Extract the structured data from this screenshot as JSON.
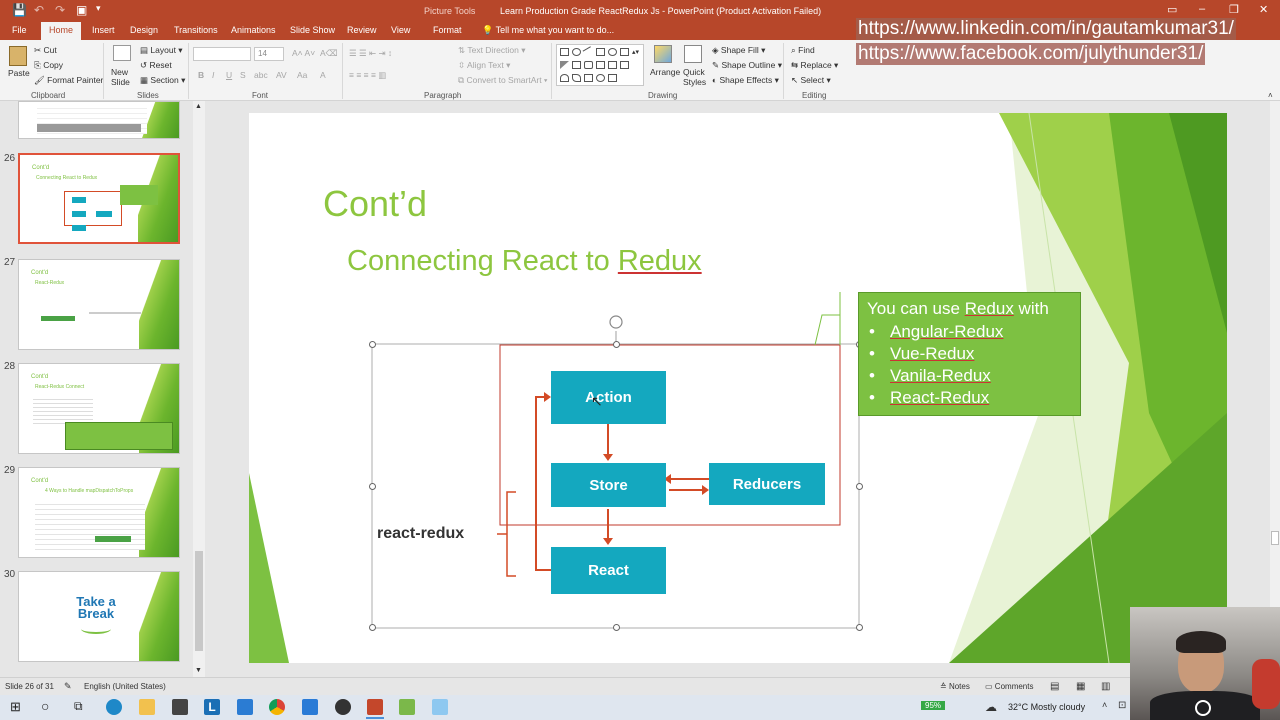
{
  "window": {
    "context_tab_label": "Picture Tools",
    "title": "Learn Production Grade ReactRedux Js - PowerPoint (Product Activation Failed)"
  },
  "tabs": [
    "File",
    "Home",
    "Insert",
    "Design",
    "Transitions",
    "Animations",
    "Slide Show",
    "Review",
    "View",
    "Format"
  ],
  "active_tab": "Home",
  "tell_me_placeholder": "Tell me what you want to do...",
  "ribbon": {
    "clipboard": {
      "paste": "Paste",
      "cut": "Cut",
      "copy": "Copy",
      "format_painter": "Format Painter",
      "group": "Clipboard"
    },
    "slides": {
      "new_slide": "New Slide",
      "layout": "Layout",
      "reset": "Reset",
      "section": "Section",
      "group": "Slides"
    },
    "font": {
      "group": "Font",
      "size": "14"
    },
    "paragraph": {
      "text_direction": "Text Direction",
      "align_text": "Align Text",
      "convert_smartart": "Convert to SmartArt",
      "group": "Paragraph"
    },
    "drawing": {
      "arrange": "Arrange",
      "quick_styles": "Quick Styles",
      "shape_fill": "Shape Fill",
      "shape_outline": "Shape Outline",
      "shape_effects": "Shape Effects",
      "group": "Drawing"
    },
    "editing": {
      "find": "Find",
      "replace": "Replace",
      "select": "Select",
      "group": "Editing"
    }
  },
  "overlay_urls": [
    "https://www.linkedin.com/in/gautamkumar31/",
    "https://www.facebook.com/julythunder31/"
  ],
  "thumbnails": [
    {
      "num": "26",
      "title": "Cont'd",
      "subtitle": "Connecting React to Redux",
      "selected": true
    },
    {
      "num": "27",
      "title": "Cont'd",
      "subtitle": "React-Redux",
      "selected": false
    },
    {
      "num": "28",
      "title": "Cont'd",
      "subtitle": "React-Redux Connect",
      "selected": false
    },
    {
      "num": "29",
      "title": "Cont'd",
      "subtitle": "4 Ways to Handle mapDispatchToProps",
      "selected": false
    },
    {
      "num": "30",
      "title": "Take a Break",
      "subtitle": "",
      "selected": false
    }
  ],
  "slide": {
    "title": "Cont’d",
    "subtitle_plain": "Connecting React to ",
    "subtitle_underlined": "Redux",
    "box_heading_plain": "You can use ",
    "box_heading_underlined": "Redux",
    "box_heading_tail": " with",
    "box_items": [
      "Angular-Redux",
      "Vue-Redux",
      "Vanila-Redux",
      "React-Redux"
    ],
    "diagram": {
      "action": "Action",
      "store": "Store",
      "reducers": "Reducers",
      "react": "React",
      "label": "react-redux"
    }
  },
  "status": {
    "slide_info": "Slide 26 of 31",
    "language": "English (United States)",
    "notes": "Notes",
    "comments": "Comments"
  },
  "taskbar": {
    "battery": "95%",
    "weather": "32°C  Mostly cloudy"
  },
  "colors": {
    "accent": "#b7472a",
    "slide_green": "#8dc63f",
    "teal": "#14a8bf",
    "arrow": "#d34b26"
  }
}
